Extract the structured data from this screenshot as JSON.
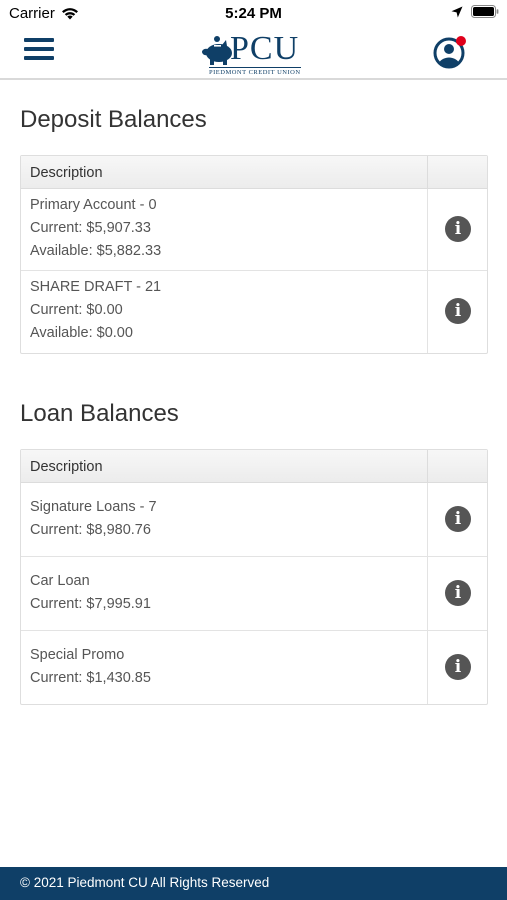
{
  "status_bar": {
    "carrier": "Carrier",
    "time": "5:24 PM",
    "icons": [
      "wifi-icon",
      "location-arrow-icon",
      "battery-icon"
    ]
  },
  "header": {
    "menu_icon": "hamburger-menu-icon",
    "logo_text": "PCU",
    "logo_subtitle": "PIEDMONT CREDIT UNION",
    "profile_icon": "user-profile-icon",
    "brand_color": "#0f3f67",
    "notification_color": "#e0001b"
  },
  "deposit": {
    "title": "Deposit Balances",
    "column_header": "Description",
    "rows": [
      {
        "name": "Primary Account - 0",
        "current": "Current: $5,907.33",
        "available": "Available: $5,882.33",
        "icon": "info-icon"
      },
      {
        "name": "SHARE DRAFT - 21",
        "current": "Current: $0.00",
        "available": "Available: $0.00",
        "icon": "info-icon"
      }
    ]
  },
  "loan": {
    "title": "Loan Balances",
    "column_header": "Description",
    "rows": [
      {
        "name": "Signature Loans - 7",
        "current": "Current: $8,980.76",
        "icon": "info-icon"
      },
      {
        "name": "Car Loan",
        "current": "Current: $7,995.91",
        "icon": "info-icon"
      },
      {
        "name": "Special Promo",
        "current": "Current: $1,430.85",
        "icon": "info-icon"
      }
    ]
  },
  "footer": {
    "text": "© 2021 Piedmont CU All Rights Reserved"
  }
}
